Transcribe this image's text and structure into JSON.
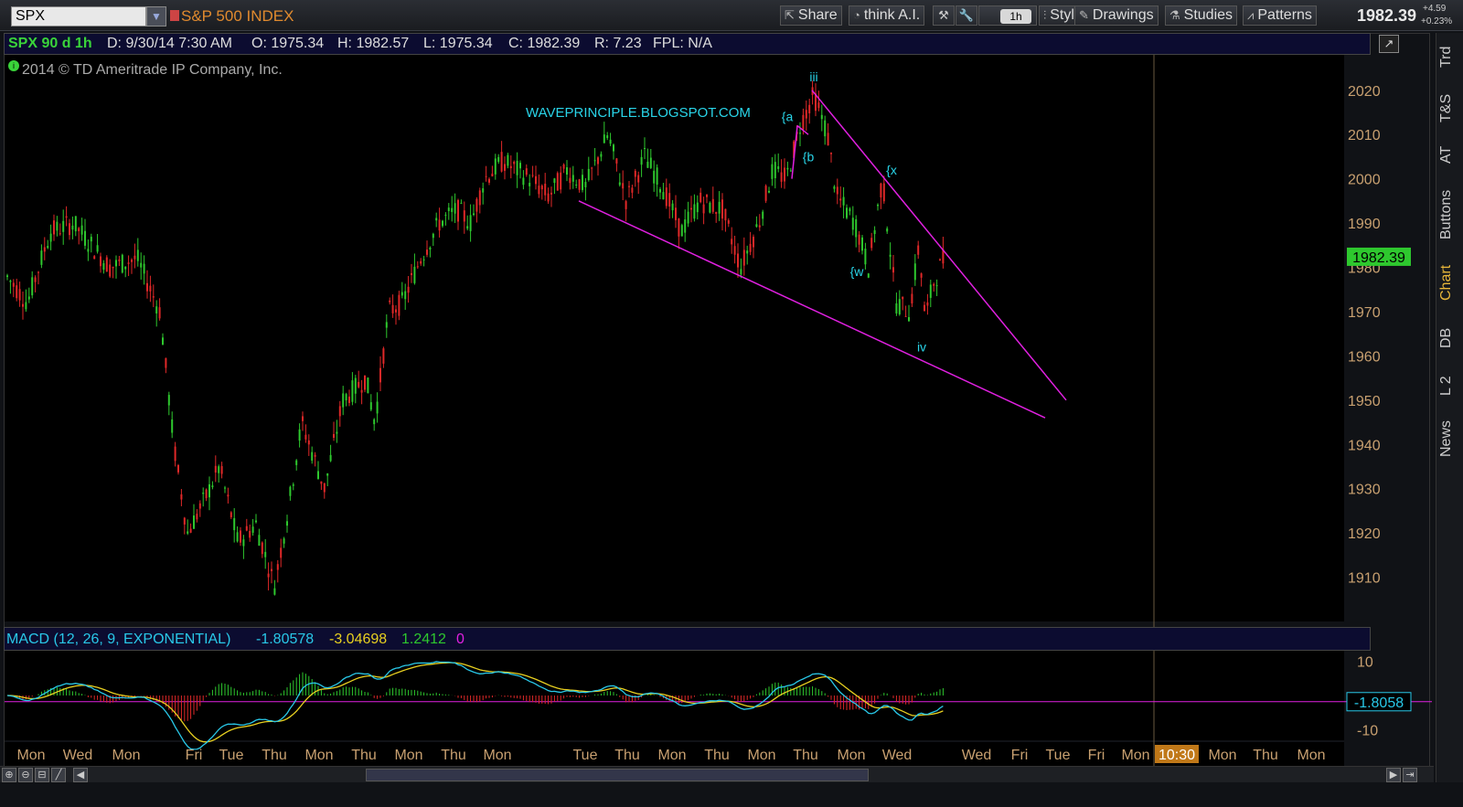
{
  "toolbar": {
    "symbol": "SPX",
    "symbol_name": "S&P 500 INDEX",
    "share": "Share",
    "think_ai": "think A.I.",
    "aggregation": "1h",
    "style": "Style",
    "drawings": "Drawings",
    "studies": "Studies",
    "patterns": "Patterns",
    "last_price": "1982.39",
    "change_abs": "+4.59",
    "change_pct": "+0.23%"
  },
  "side_tabs": [
    "Trd",
    "T&S",
    "AT",
    "Buttons",
    "Chart",
    "DB",
    "L 2",
    "News"
  ],
  "info_bar": {
    "symbol": "SPX 90 d 1h",
    "date": "D: 9/30/14 7:30 AM",
    "open": "O: 1975.34",
    "high": "H: 1982.57",
    "low": "L: 1975.34",
    "close": "C: 1982.39",
    "range": "R: 7.23",
    "fpl": "FPL: N/A"
  },
  "copyright": "2014 © TD Ameritrade IP Company, Inc.",
  "macd_bar": {
    "label": "MACD (12, 26, 9, EXPONENTIAL)",
    "value": "-1.80578",
    "avg": "-3.04698",
    "diff": "1.2412",
    "zero": "0"
  },
  "colors": {
    "up": "#2ec82e",
    "down": "#e02828",
    "trendline": "#e020e0",
    "annotation": "#29d4e8",
    "axis_text": "#c8a070",
    "macd_value": "#29c8e8",
    "macd_avg": "#e8d020",
    "macd_diff_up": "#2ec82e",
    "macd_zero": "#e020e0"
  },
  "chart_data": {
    "type": "candlestick",
    "title": "S&P 500 INDEX",
    "ylim": [
      1900,
      2028
    ],
    "y_ticks": [
      1910,
      1920,
      1930,
      1940,
      1950,
      1960,
      1970,
      1980,
      1990,
      2000,
      2010,
      2020
    ],
    "x_ticks": [
      "Mon",
      "Wed",
      "Mon",
      "Fri",
      "Tue",
      "Thu",
      "Mon",
      "Thu",
      "Mon",
      "Thu",
      "Mon",
      "Tue",
      "Thu",
      "Mon",
      "Thu",
      "Mon",
      "Thu",
      "Mon",
      "Wed",
      "Wed",
      "Fri",
      "Tue",
      "Fri",
      "Mon",
      "10:30",
      "Mon",
      "Thu",
      "Mon"
    ],
    "price_path": [
      [
        0,
        1980
      ],
      [
        30,
        1972
      ],
      [
        55,
        1988
      ],
      [
        80,
        1990
      ],
      [
        100,
        1985
      ],
      [
        120,
        1980
      ],
      [
        150,
        1982
      ],
      [
        175,
        1970
      ],
      [
        190,
        1940
      ],
      [
        205,
        1920
      ],
      [
        225,
        1928
      ],
      [
        240,
        1935
      ],
      [
        260,
        1918
      ],
      [
        280,
        1922
      ],
      [
        300,
        1908
      ],
      [
        315,
        1925
      ],
      [
        330,
        1945
      ],
      [
        355,
        1930
      ],
      [
        375,
        1950
      ],
      [
        400,
        1955
      ],
      [
        410,
        1945
      ],
      [
        425,
        1970
      ],
      [
        440,
        1972
      ],
      [
        460,
        1982
      ],
      [
        480,
        1990
      ],
      [
        500,
        1993
      ],
      [
        515,
        1990
      ],
      [
        530,
        2000
      ],
      [
        550,
        2004
      ],
      [
        580,
        2000
      ],
      [
        600,
        1996
      ],
      [
        620,
        2002
      ],
      [
        640,
        1998
      ],
      [
        665,
        2010
      ],
      [
        685,
        1995
      ],
      [
        705,
        2005
      ],
      [
        725,
        1998
      ],
      [
        745,
        1988
      ],
      [
        765,
        1995
      ],
      [
        790,
        1993
      ],
      [
        810,
        1980
      ],
      [
        830,
        1990
      ],
      [
        845,
        2002
      ],
      [
        860,
        2000
      ],
      [
        875,
        2012
      ],
      [
        890,
        2019
      ],
      [
        905,
        2010
      ],
      [
        915,
        1996
      ],
      [
        935,
        1990
      ],
      [
        950,
        1980
      ],
      [
        965,
        2000
      ],
      [
        980,
        1972
      ],
      [
        995,
        1970
      ],
      [
        1005,
        1985
      ],
      [
        1012,
        1968
      ],
      [
        1020,
        1976
      ],
      [
        1032,
        1982
      ]
    ],
    "annotations": [
      {
        "text": "iii",
        "x": 890,
        "y": 2022
      },
      {
        "text": "{a",
        "x": 861,
        "y": 2013
      },
      {
        "text": "{b",
        "x": 884,
        "y": 2004
      },
      {
        "text": "{x",
        "x": 975,
        "y": 2001
      },
      {
        "text": "{w",
        "x": 937,
        "y": 1978
      },
      {
        "text": "iv",
        "x": 1008,
        "y": 1961
      },
      {
        "text": "WAVEPRINCIPLE.BLOGSPOT.COM",
        "x": 698,
        "y": 2014
      }
    ],
    "trendlines": [
      {
        "x1": 633,
        "y1": 1995,
        "x2": 1143,
        "y2": 1946
      },
      {
        "x1": 888,
        "y1": 2020,
        "x2": 1166,
        "y2": 1950
      }
    ],
    "price_label": "1982.39",
    "macd": {
      "ylim": [
        -13,
        13
      ],
      "y_ticks": [
        10,
        -10
      ],
      "value_label": "-1.8058"
    }
  }
}
